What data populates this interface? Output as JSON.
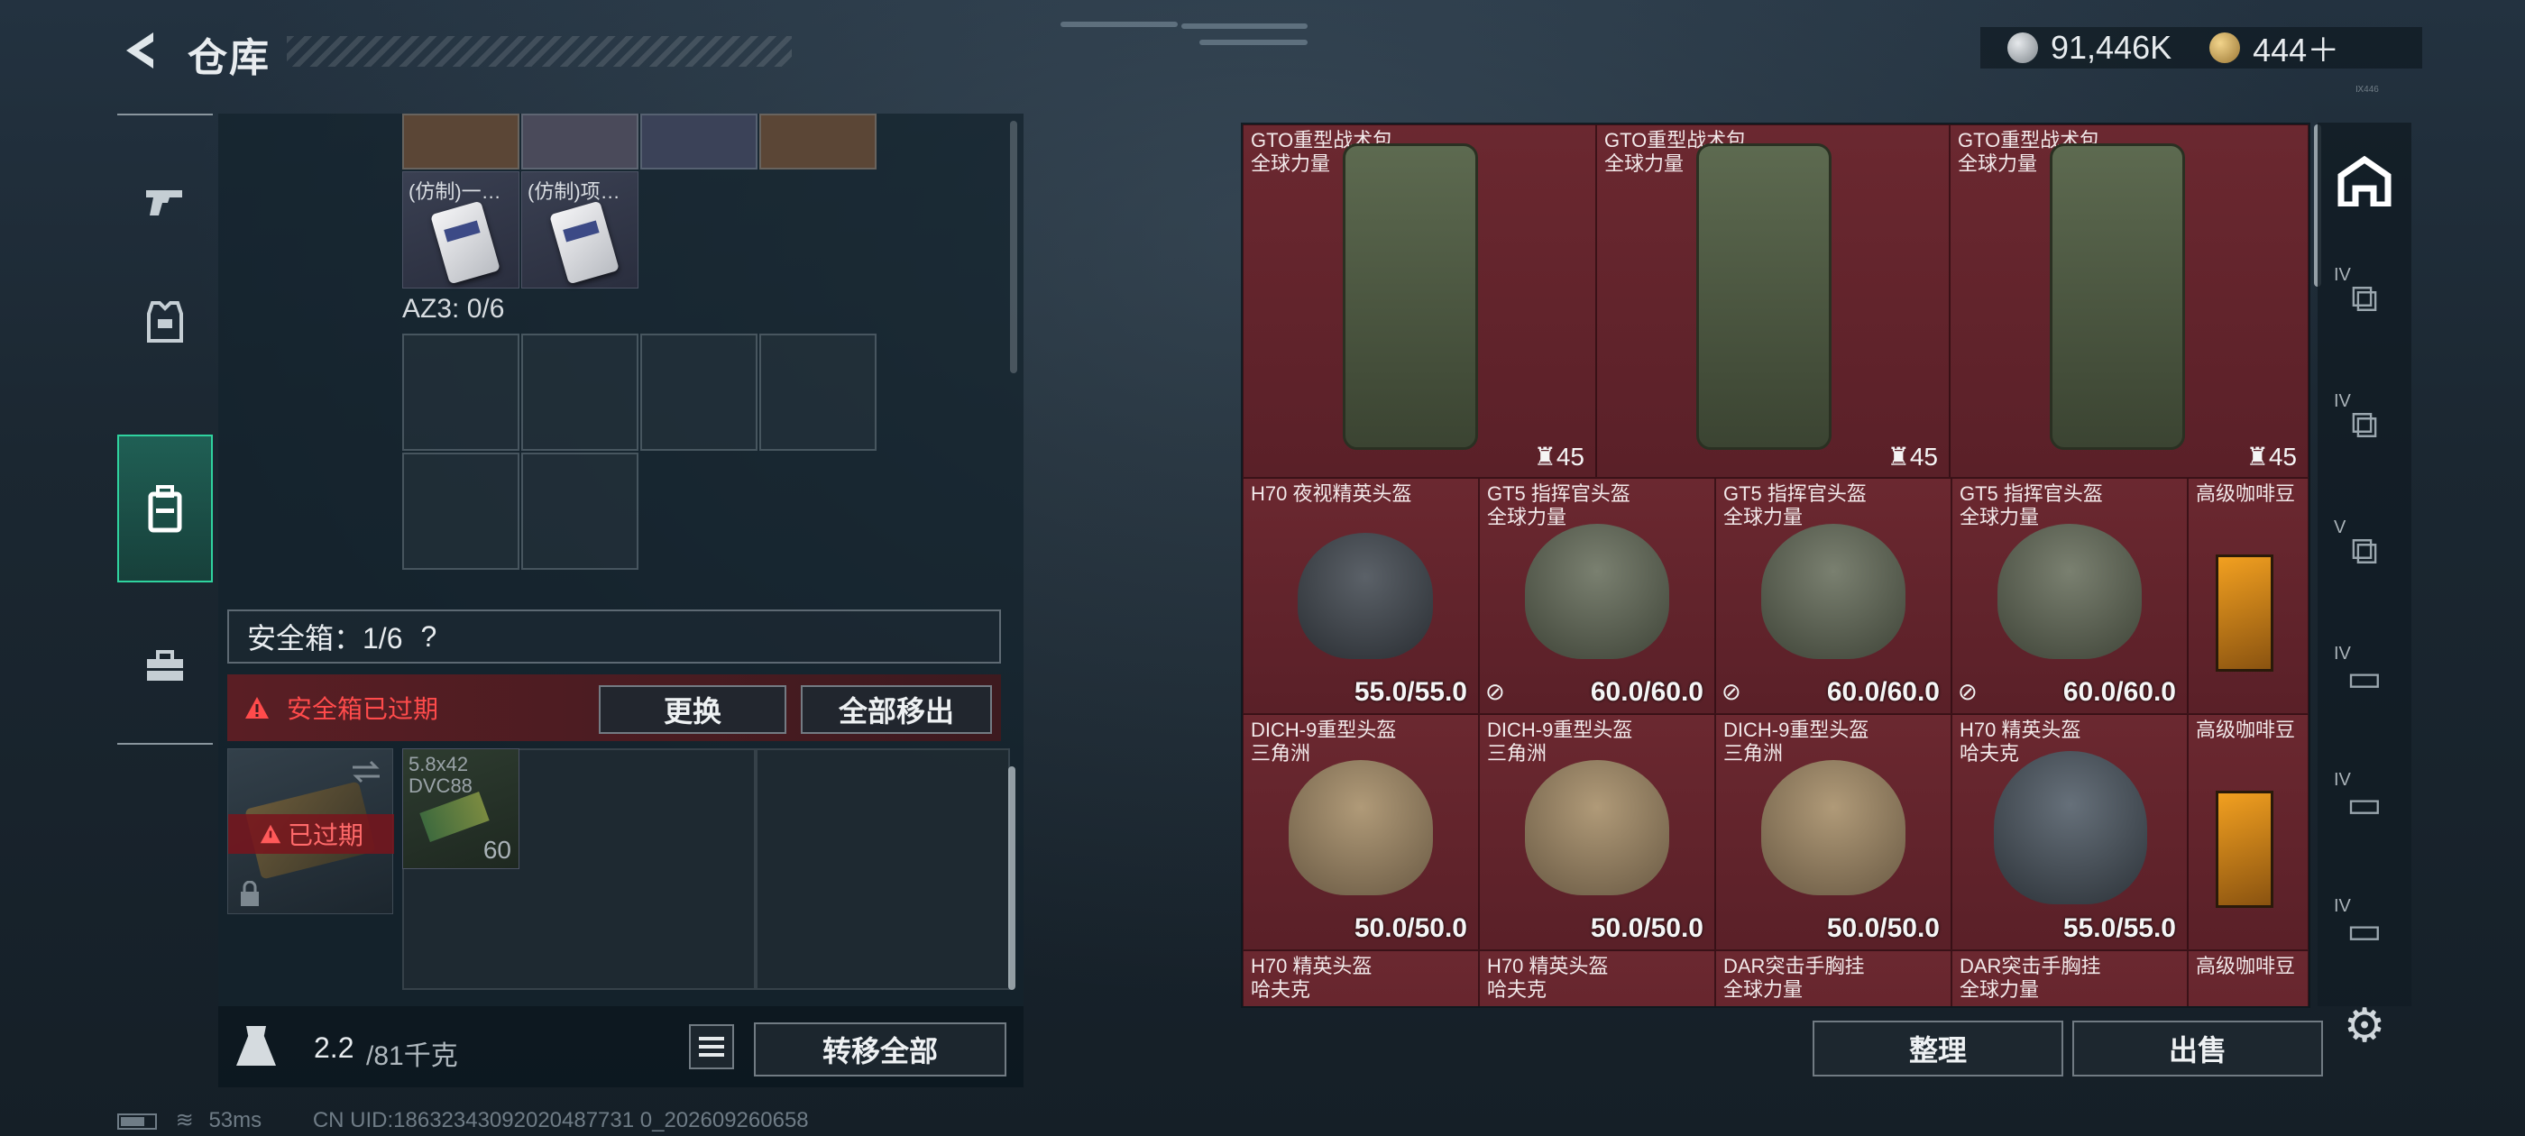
{
  "header": {
    "back_icon": "back-arrow-icon",
    "title": "仓库"
  },
  "currency": {
    "silver_amount": "91,446K",
    "gold_amount": "444＋",
    "plus_icon": "plus-icon",
    "tiny_text": "Ⅸ446"
  },
  "left_tabs": [
    {
      "icon": "pistol-icon"
    },
    {
      "icon": "armor-icon"
    },
    {
      "icon": "backpack-icon",
      "active": true
    },
    {
      "icon": "toolbox-icon"
    }
  ],
  "container": {
    "items": [
      {
        "label": "(仿制)一…"
      },
      {
        "label": "(仿制)项…"
      }
    ],
    "az3_label": "AZ3: 0/6",
    "safe_box_label": "安全箱：1/6",
    "safe_box_help": "?",
    "expired_warning": "安全箱已过期",
    "replace_button": "更换",
    "remove_all_button": "全部移出",
    "expired_badge": "已过期",
    "ammo": {
      "name_line1": "5.8x42",
      "name_line2": "DVC88",
      "count": "60"
    }
  },
  "weight": {
    "current": "2.2",
    "max": "/81千克",
    "transfer_all": "转移全部"
  },
  "status_bar": {
    "ping": "53ms",
    "uid": "CN UID:18632343092020487731 0_202609260658"
  },
  "warehouse": {
    "backpacks": [
      {
        "name": "GTO重型战术包",
        "tag": "全球力量",
        "capacity": "45"
      },
      {
        "name": "GTO重型战术包",
        "tag": "全球力量",
        "capacity": "45"
      },
      {
        "name": "GTO重型战术包",
        "tag": "全球力量",
        "capacity": "45"
      }
    ],
    "row2": [
      {
        "name": "H70 夜视精英头盔",
        "tag": "",
        "durability": "55.0/55.0"
      },
      {
        "name": "GT5 指挥官头盔",
        "tag": "全球力量",
        "durability": "60.0/60.0"
      },
      {
        "name": "GT5 指挥官头盔",
        "tag": "全球力量",
        "durability": "60.0/60.0"
      },
      {
        "name": "GT5 指挥官头盔",
        "tag": "全球力量",
        "durability": "60.0/60.0"
      },
      {
        "name": "高级咖啡豆",
        "tag": ""
      }
    ],
    "row3": [
      {
        "name": "DICH-9重型头盔",
        "tag": "三角洲",
        "durability": "50.0/50.0"
      },
      {
        "name": "DICH-9重型头盔",
        "tag": "三角洲",
        "durability": "50.0/50.0"
      },
      {
        "name": "DICH-9重型头盔",
        "tag": "三角洲",
        "durability": "50.0/50.0"
      },
      {
        "name": "H70 精英头盔",
        "tag": "哈夫克",
        "durability": "55.0/55.0"
      },
      {
        "name": "高级咖啡豆",
        "tag": ""
      }
    ],
    "row4": [
      {
        "name": "H70 精英头盔",
        "tag": "哈夫克"
      },
      {
        "name": "H70 精英头盔",
        "tag": "哈夫克"
      },
      {
        "name": "DAR突击手胸挂",
        "tag": "全球力量"
      },
      {
        "name": "DAR突击手胸挂",
        "tag": "全球力量"
      },
      {
        "name": "高级咖啡豆",
        "tag": ""
      }
    ],
    "sort_button": "整理",
    "sell_button": "出售"
  },
  "right_tabs": [
    {
      "icon": "home-icon",
      "level": ""
    },
    {
      "icon": "storage-icon",
      "level": "IV"
    },
    {
      "icon": "storage-icon",
      "level": "IV"
    },
    {
      "icon": "storage-icon",
      "level": "V"
    },
    {
      "icon": "storage-icon",
      "level": "IV"
    },
    {
      "icon": "storage-icon",
      "level": "IV"
    },
    {
      "icon": "storage-icon",
      "level": "IV"
    }
  ],
  "settings_icon": "gear-icon"
}
